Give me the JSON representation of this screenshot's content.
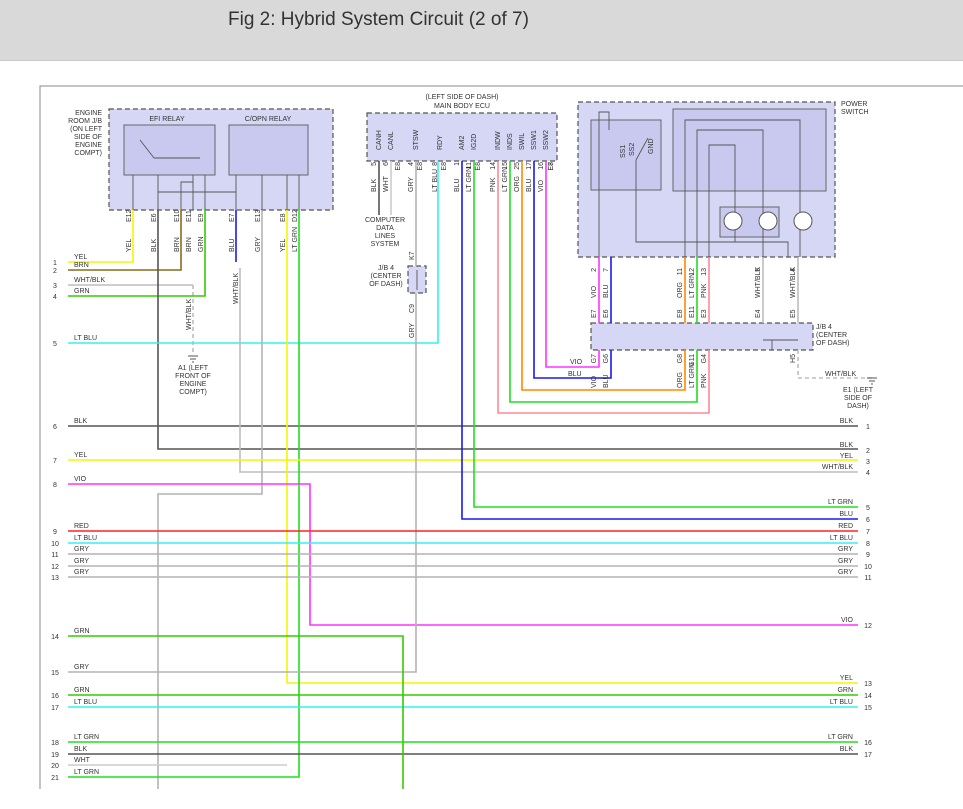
{
  "header": {
    "title": "Fig 2: Hybrid System Circuit (2 of 7)"
  },
  "colors": {
    "YEL": "#f5f500",
    "BRN": "#8b6a1c",
    "WHT/BLK": "#bdbdbd",
    "GRN": "#33cc00",
    "LT BLU": "#33f0f0",
    "BLK": "#555555",
    "VIO": "#ff33ff",
    "RED": "#ff2222",
    "GRY": "#b4b4b4",
    "LT GRN": "#22dd22",
    "WHT": "#cccccc",
    "BLU": "#1a1aee",
    "PNK": "#ff8899",
    "ORG": "#ff8800"
  },
  "components": {
    "engine_room_jb": "ENGINE ROOM J/B (ON LEFT SIDE OF ENGINE COMPT)",
    "efi_relay": "EFI RELAY",
    "copn_relay": "C/OPN RELAY",
    "ecu_location": "(LEFT SIDE OF DASH)",
    "ecu_name": "MAIN BODY ECU",
    "ecu_pins": [
      "CANH",
      "CANL",
      "STSW",
      "RDY",
      "AM2",
      "IG2D",
      "INDW",
      "INDS",
      "SWIL",
      "SSW1",
      "SSW2"
    ],
    "computer_data": "COMPUTER DATA LINES SYSTEM",
    "jb4_small": "J/B 4 (CENTER OF DASH)",
    "power_switch": "POWER SWITCH",
    "ps_pins": [
      "SS1",
      "SS2",
      "GND"
    ],
    "jb4": "J/B 4 (CENTER OF DASH)",
    "ground_a1": "A1 (LEFT FRONT OF ENGINE COMPT)",
    "ground_e1": "E1 (LEFT SIDE OF DASH)"
  },
  "wire_labels": {
    "relay": [
      [
        "E12",
        "YEL"
      ],
      [
        "E6",
        "BLK"
      ],
      [
        "E10",
        "BRN"
      ],
      [
        "E11",
        "BRN"
      ],
      [
        "E9",
        "GRN"
      ],
      [
        "E7",
        "BLU"
      ],
      [
        "E13",
        "GRY"
      ],
      [
        "E8",
        "YEL"
      ],
      [
        "D12",
        "LT GRN"
      ]
    ],
    "ecu": [
      [
        "5",
        "BLK"
      ],
      [
        "6",
        "WHT"
      ],
      [
        "4",
        "GRY"
      ],
      [
        "8",
        "LT BLU"
      ],
      [
        "1",
        "BLU"
      ],
      [
        "11",
        "LT GRN"
      ],
      [
        "14",
        "PNK"
      ],
      [
        "15",
        "LT GRN"
      ],
      [
        "25",
        "ORG"
      ],
      [
        "17",
        "BLU"
      ],
      [
        "16",
        "VIO"
      ]
    ],
    "ecu_conn": [
      "E8",
      "E8",
      "E8",
      "E8",
      "E8",
      "E7"
    ],
    "ps": [
      [
        "2",
        "VIO"
      ],
      [
        "7",
        "BLU"
      ],
      [
        "11",
        "ORG"
      ],
      [
        "12",
        "LT GRN"
      ],
      [
        "13",
        "PNK"
      ],
      [
        "5",
        "WHT/BLK"
      ],
      [
        "4",
        "WHT/BLK"
      ]
    ],
    "jb_top": [
      "E7",
      "E6",
      "E8",
      "E11",
      "E3",
      "E4",
      "E5"
    ],
    "jb_bot": [
      [
        "G7",
        "VIO"
      ],
      [
        "G6",
        "BLU"
      ],
      [
        "G8",
        "ORG"
      ],
      [
        "G11",
        "LT GRN"
      ],
      [
        "G4",
        "PNK"
      ],
      [
        "H5",
        "WHT/BLK"
      ]
    ],
    "misc": {
      "whtblk_a1": "WHT/BLK",
      "whtblk_e7": "WHT/BLK",
      "k7": "K7",
      "c9": "C9",
      "gry_c9": "GRY",
      "vio_h": "VIO",
      "blu_h": "BLU"
    }
  },
  "left_pins": [
    [
      "1",
      "YEL"
    ],
    [
      "2",
      "BRN"
    ],
    [
      "3",
      "WHT/BLK"
    ],
    [
      "4",
      "GRN"
    ],
    [
      "5",
      "LT BLU"
    ],
    [
      "6",
      "BLK"
    ],
    [
      "7",
      "YEL"
    ],
    [
      "8",
      "VIO"
    ],
    [
      "9",
      "RED"
    ],
    [
      "10",
      "LT BLU"
    ],
    [
      "11",
      "GRY"
    ],
    [
      "12",
      "GRY"
    ],
    [
      "13",
      "GRY"
    ],
    [
      "14",
      "GRN"
    ],
    [
      "15",
      "GRY"
    ],
    [
      "16",
      "GRN"
    ],
    [
      "17",
      "LT BLU"
    ],
    [
      "18",
      "LT GRN"
    ],
    [
      "19",
      "BLK"
    ],
    [
      "20",
      "WHT"
    ],
    [
      "21",
      "LT GRN"
    ]
  ],
  "right_pins": [
    [
      "1",
      "BLK"
    ],
    [
      "2",
      "BLK"
    ],
    [
      "3",
      "YEL"
    ],
    [
      "4",
      "WHT/BLK"
    ],
    [
      "5",
      "LT GRN"
    ],
    [
      "6",
      "BLU"
    ],
    [
      "7",
      "RED"
    ],
    [
      "8",
      "LT BLU"
    ],
    [
      "9",
      "GRY"
    ],
    [
      "10",
      "GRY"
    ],
    [
      "11",
      "GRY"
    ],
    [
      "12",
      "VIO"
    ],
    [
      "13",
      "YEL"
    ],
    [
      "14",
      "GRN"
    ],
    [
      "15",
      "LT BLU"
    ],
    [
      "16",
      "LT GRN"
    ],
    [
      "17",
      "BLK"
    ]
  ]
}
